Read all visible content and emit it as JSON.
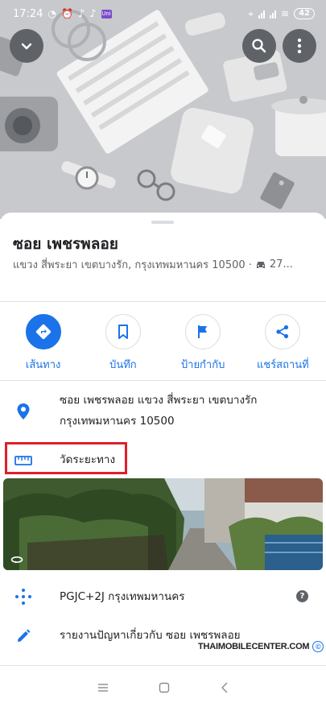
{
  "status_bar": {
    "time": "17:24",
    "battery": "42",
    "app_badge": "Uni"
  },
  "place": {
    "title": "ซอย เพชรพลอย",
    "subtitle": "แขวง สี่พระยา เขตบางรัก, กรุงเทพมหานคร 10500 ·",
    "drive_time": "27..."
  },
  "actions": [
    {
      "label": "เส้นทาง",
      "icon": "directions-icon"
    },
    {
      "label": "บันทึก",
      "icon": "bookmark-icon"
    },
    {
      "label": "ป้ายกำกับ",
      "icon": "flag-icon"
    },
    {
      "label": "แชร์สถานที่",
      "icon": "share-icon"
    }
  ],
  "address": {
    "line1": "ซอย เพชรพลอย แขวง สี่พระยา เขตบางรัก",
    "line2": "กรุงเทพมหานคร 10500"
  },
  "measure": {
    "label": "วัดระยะทาง"
  },
  "plus_code": {
    "text": "PGJC+2J กรุงเทพมหานคร",
    "help": "?"
  },
  "report": {
    "text": "รายงานปัญหาเกี่ยวกับ ซอย เพชรพลอย"
  },
  "watermark": {
    "text": "THAIMOBILECENTER.COM",
    "symbol": "©"
  },
  "colors": {
    "accent": "#1a73e8",
    "highlight": "#e01e2b",
    "hero_bg": "#c8c9cc"
  }
}
